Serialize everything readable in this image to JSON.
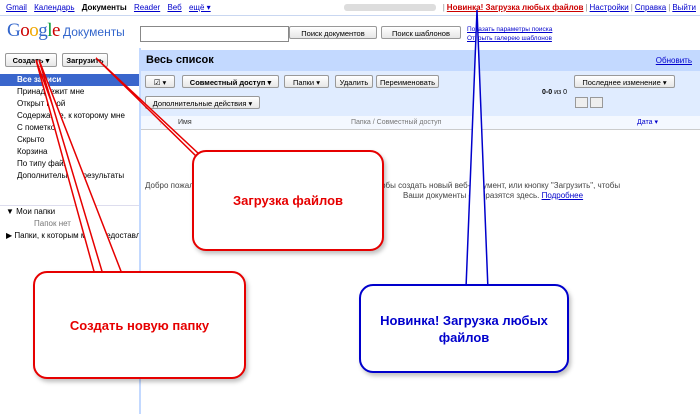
{
  "topbar": {
    "nav": [
      "Gmail",
      "Календарь",
      "Документы",
      "Reader",
      "Веб",
      "ещё ▾"
    ],
    "right": [
      "Новинка! Загрузка любых файлов",
      "Настройки",
      "Справка",
      "Выйти"
    ]
  },
  "logo": {
    "google": "Google",
    "product": "Документы"
  },
  "search": {
    "docs_button": "Поиск документов",
    "templates_button": "Поиск шаблонов",
    "show_options": "Показать параметры поиска",
    "template_gallery": "Открыть галерею шаблонов"
  },
  "left": {
    "create_label": "Создать ▾",
    "upload_label": "Загрузить",
    "items": [
      "Все записи",
      "Принадлежит мне",
      "Открыт мной",
      "Содержание, к которому мне",
      "С пометкой",
      "Скрыто",
      "Корзина",
      "По типу файла ▾",
      "Дополнительные результаты"
    ],
    "my_folders": "Мои папки",
    "no_folders": "Папок нет",
    "shared_folders": "Папки, к которым мне предоставлен доступ"
  },
  "main": {
    "title": "Весь список",
    "refresh": "Обновить",
    "toolbar": {
      "check": "☑ ▾",
      "share": "Совместный доступ ▾",
      "folders": "Папки ▾",
      "delete": "Удалить",
      "rename": "Переименовать",
      "more_actions": "Дополнительные действия ▾",
      "sort": "Последнее изменение ▾",
      "count_range": "0-0",
      "count_of": "из 0"
    },
    "columns": {
      "name": "Имя",
      "folder": "Папка / Совместный доступ",
      "date": "Дата ▾"
    },
    "welcome_line1": "Добро пожаловать в Документы Google! Нажмите \"Создать\", чтобы создать новый веб-документ, или кнопку \"Загрузить\", чтобы",
    "welcome_line2": "Ваши документы отобразятся здесь.",
    "welcome_link": "Подробнее"
  },
  "callouts": {
    "upload": "Загрузка файлов",
    "create_folder": "Создать новую папку",
    "new_feature": "Новинка! Загрузка любых файлов"
  },
  "colors": {
    "red": "#e60000",
    "blue": "#0000cc",
    "header": "#c3d9ff",
    "toolbar": "#e0ecff",
    "selected": "#3a66cc"
  }
}
